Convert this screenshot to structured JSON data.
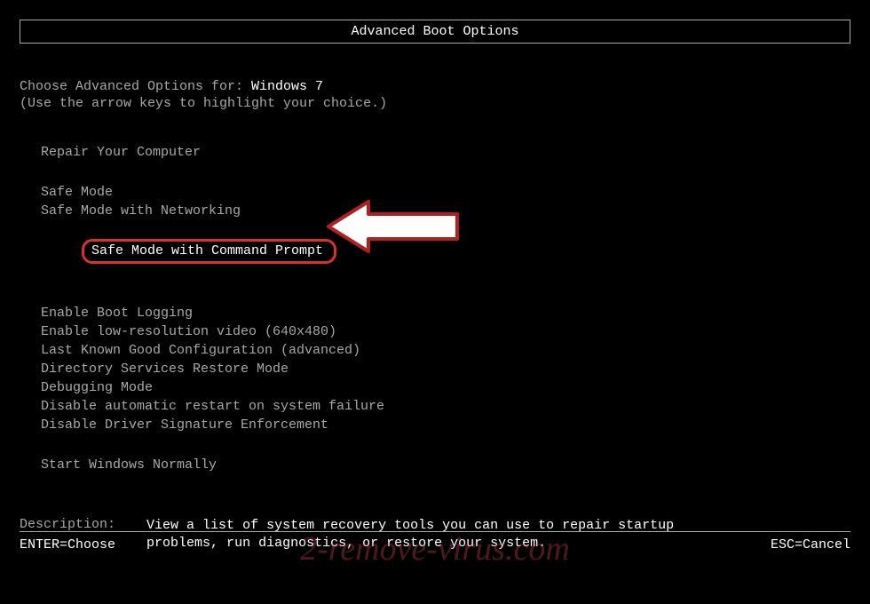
{
  "title": "Advanced Boot Options",
  "choose_prefix": "Choose Advanced Options for: ",
  "os_name": "Windows 7",
  "instruction": "(Use the arrow keys to highlight your choice.)",
  "menu": {
    "group1": [
      "Repair Your Computer"
    ],
    "group2": [
      "Safe Mode",
      "Safe Mode with Networking",
      "Safe Mode with Command Prompt"
    ],
    "group3": [
      "Enable Boot Logging",
      "Enable low-resolution video (640x480)",
      "Last Known Good Configuration (advanced)",
      "Directory Services Restore Mode",
      "Debugging Mode",
      "Disable automatic restart on system failure",
      "Disable Driver Signature Enforcement"
    ],
    "group4": [
      "Start Windows Normally"
    ]
  },
  "highlighted_item": "Safe Mode with Command Prompt",
  "description": {
    "label": "Description:",
    "text": "View a list of system recovery tools you can use to repair startup problems, run diagnostics, or restore your system."
  },
  "footer": {
    "enter": "ENTER=Choose",
    "esc": "ESC=Cancel"
  },
  "watermark": "2-remove-virus.com"
}
